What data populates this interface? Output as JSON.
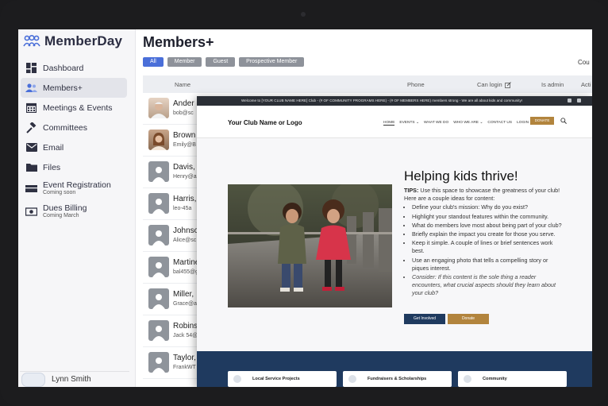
{
  "app": {
    "name": "MemberDay"
  },
  "sidebar": {
    "items": [
      {
        "label": "Dashboard",
        "icon": "dashboard-icon",
        "sub": ""
      },
      {
        "label": "Members+",
        "icon": "users-icon",
        "sub": ""
      },
      {
        "label": "Meetings & Events",
        "icon": "calendar-icon",
        "sub": ""
      },
      {
        "label": "Committees",
        "icon": "gavel-icon",
        "sub": ""
      },
      {
        "label": "Email",
        "icon": "envelope-icon",
        "sub": ""
      },
      {
        "label": "Files",
        "icon": "folder-icon",
        "sub": ""
      },
      {
        "label": "Event Registration",
        "icon": "ticket-icon",
        "sub": "Coming soon"
      },
      {
        "label": "Dues Billing",
        "icon": "money-icon",
        "sub": "Coming March"
      }
    ],
    "user": {
      "name": "Lynn Smith"
    }
  },
  "main": {
    "title": "Members+",
    "filters": [
      "All",
      "Member",
      "Guest",
      "Prospective Member"
    ],
    "count_label": "Cou",
    "columns": {
      "name": "Name",
      "phone": "Phone",
      "can_login": "Can login",
      "is_admin": "Is admin",
      "active": "Acti"
    },
    "rows": [
      {
        "name": "Ander",
        "email": "bob@sc"
      },
      {
        "name": "Brown",
        "email": "Emily@B"
      },
      {
        "name": "Davis,",
        "email": "Henry@a"
      },
      {
        "name": "Harris,",
        "email": "leo-45a"
      },
      {
        "name": "Johnso",
        "email": "Alice@sc"
      },
      {
        "name": "Martine",
        "email": "bal455@g"
      },
      {
        "name": "Miller,",
        "email": "Grace@a"
      },
      {
        "name": "Robins",
        "email": "Jack 54@"
      },
      {
        "name": "Taylor,",
        "email": "FrankWT"
      }
    ]
  },
  "site": {
    "announcement": "Welcome to [YOUR CLUB NAME HERE] Club - (# OF COMMUNITY PROGRAMS HERE) - (# OF MEMBERS HERE) members strong - We are all about kids and community!",
    "logo": "Your Club Name or Logo",
    "menu": [
      "HOME",
      "EVENTS",
      "WHAT WE DO",
      "WHO WE ARE",
      "CONTACT US",
      "LOGIN"
    ],
    "donate_label": "DONATE",
    "hero_title": "Helping kids thrive!",
    "tips_label": "TIPS:",
    "tips_intro": "Use this space to showcase the greatness of your club! Here are a couple ideas for content:",
    "tips": [
      "Define your club's mission: Why do you exist?",
      "Highlight your standout features within the community.",
      "What do members love most about being part of your club?",
      "Briefly explain the impact you create for those you serve.",
      "Keep it simple. A couple of lines or brief sentences work best.",
      "Use an engaging photo that tells a compelling story or piques interest."
    ],
    "tip_italic": "Consider: If this content is the sole thing a reader encounters, what crucial aspects should they learn about your club?",
    "cta_primary": "Get Involved",
    "cta_secondary": "Donate",
    "cards": [
      "Local Service Projects",
      "Fundraisers & Scholarships",
      "Community"
    ]
  },
  "colors": {
    "accent": "#4a6fd9",
    "navy": "#1f3a5f",
    "gold": "#b2843d"
  }
}
